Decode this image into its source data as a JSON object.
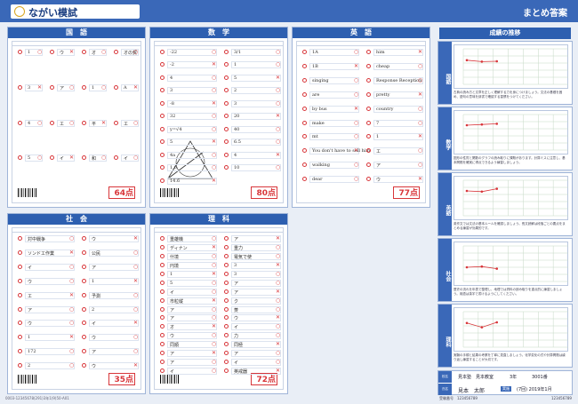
{
  "header": {
    "logo": "ながい模試",
    "title": "まとめ答案"
  },
  "subjects": [
    {
      "key": "kokugo",
      "name": "国　語",
      "score": "64点"
    },
    {
      "key": "sugaku",
      "name": "数　学",
      "score": "80点"
    },
    {
      "key": "eigo",
      "name": "英　語",
      "score": "77点"
    },
    {
      "key": "shakai",
      "name": "社　会",
      "score": "35点"
    },
    {
      "key": "rika",
      "name": "理　科",
      "score": "72点"
    }
  ],
  "kokugo": {
    "answers": [
      "1",
      "3",
      "4",
      "5",
      "ウ",
      "ア",
      "エ",
      "イ",
      "オ",
      "1",
      "平",
      "和",
      "オの賀",
      "A",
      "エ",
      "イ"
    ]
  },
  "sugaku": {
    "answers": [
      "-22",
      "-2",
      "4",
      "3",
      "-8",
      "32",
      "y=√4",
      "5",
      "4a",
      "1.6",
      "14.6",
      "3/1",
      "1",
      "5",
      "2",
      "3",
      "20",
      "40",
      "6.5",
      "4",
      "10"
    ]
  },
  "eigo": {
    "answers": [
      "1A",
      "1B",
      "singing",
      "are",
      "by bus",
      "make",
      "mt",
      "You don't have to sell him",
      "walking",
      "dear",
      "him",
      "cheap",
      "Response Reception",
      "pretty",
      "country",
      "7",
      "1",
      "エ",
      "ア",
      "ウ"
    ]
  },
  "shakai": {
    "answers": [
      "対中戦争",
      "ソンドエ作業",
      "イ",
      "ウ",
      "エ",
      "ア",
      "ウ",
      "1",
      "172",
      "2",
      "ウ",
      "公民",
      "ア",
      "1",
      "予測",
      "2",
      "イ",
      "ウ",
      "ア",
      "ウ"
    ]
  },
  "rika": {
    "answers": [
      "重雄機",
      "ディナン",
      "什境",
      "円境",
      "1",
      "5",
      "イ",
      "市粒縦",
      "ア",
      "ア",
      "オ",
      "ウ",
      "同順",
      "ア",
      "ア",
      "イ",
      "ア",
      "重力",
      "電気で使",
      "3",
      "3",
      "ア",
      "ア",
      "ク",
      "菱",
      "ウ",
      "イ",
      "力",
      "同極",
      "ア",
      "イ",
      "英戒器"
    ]
  },
  "right": {
    "title": "成績の推移",
    "blocks": [
      {
        "name": "国語",
        "comment": "古典の読み方と文章を正しく理解する力を身につけましょう。文法の基礎を固め、語句の意味を辞書で確認する習慣をつけてください。"
      },
      {
        "name": "数学",
        "comment": "図形の性質と関数のグラフの読み取りに課題があります。計算ミスに注意し、基本問題を確実に得点できるよう練習しましょう。"
      },
      {
        "name": "英語",
        "comment": "英作文では文法の基本ルールを確認しましょう。長文読解は段落ごとの要点をまとめる練習が効果的です。"
      },
      {
        "name": "社会",
        "comment": "歴史の流れを年表で整理し、地理では資料の読み取りを重点的に練習しましょう。用語は漢字で書けるようにしてください。"
      },
      {
        "name": "理科",
        "comment": "実験の手順と結果の考察を丁寧に見直しましょう。化学変化の式や計算問題は繰り返し練習することが大切です。"
      }
    ]
  },
  "info": {
    "label1": "校名",
    "school": "見本塾　見本教室",
    "grade": "3年",
    "number": "3001番",
    "label2": "氏名",
    "name": "見本　太郎",
    "date_label": "実施",
    "date": "(7回) 2019年1月"
  },
  "footer": {
    "left": "0003-12345678(291)3年1(9)50-A01",
    "center": "受験番号　123456789",
    "right": "123456789"
  },
  "chart_data": [
    {
      "type": "line",
      "subject": "国語",
      "categories": [
        "1",
        "2",
        "3",
        "4",
        "5",
        "6",
        "7"
      ],
      "values": [
        68,
        64,
        65,
        null,
        null,
        null,
        null
      ],
      "ylim": [
        0,
        100
      ]
    },
    {
      "type": "line",
      "subject": "数学",
      "categories": [
        "1",
        "2",
        "3",
        "4",
        "5",
        "6",
        "7"
      ],
      "values": [
        70,
        72,
        74,
        null,
        null,
        null,
        null
      ],
      "ylim": [
        0,
        100
      ]
    },
    {
      "type": "line",
      "subject": "英語",
      "categories": [
        "1",
        "2",
        "3",
        "4",
        "5",
        "6",
        "7"
      ],
      "values": [
        70,
        68,
        76,
        null,
        null,
        null,
        null
      ],
      "ylim": [
        0,
        100
      ]
    },
    {
      "type": "line",
      "subject": "社会",
      "categories": [
        "1",
        "2",
        "3",
        "4",
        "5",
        "6",
        "7"
      ],
      "values": [
        40,
        42,
        36,
        null,
        null,
        null,
        null
      ],
      "ylim": [
        0,
        100
      ]
    },
    {
      "type": "line",
      "subject": "理科",
      "categories": [
        "1",
        "2",
        "3",
        "4",
        "5",
        "6",
        "7"
      ],
      "values": [
        68,
        56,
        70,
        null,
        null,
        null,
        null
      ],
      "ylim": [
        0,
        100
      ]
    }
  ]
}
